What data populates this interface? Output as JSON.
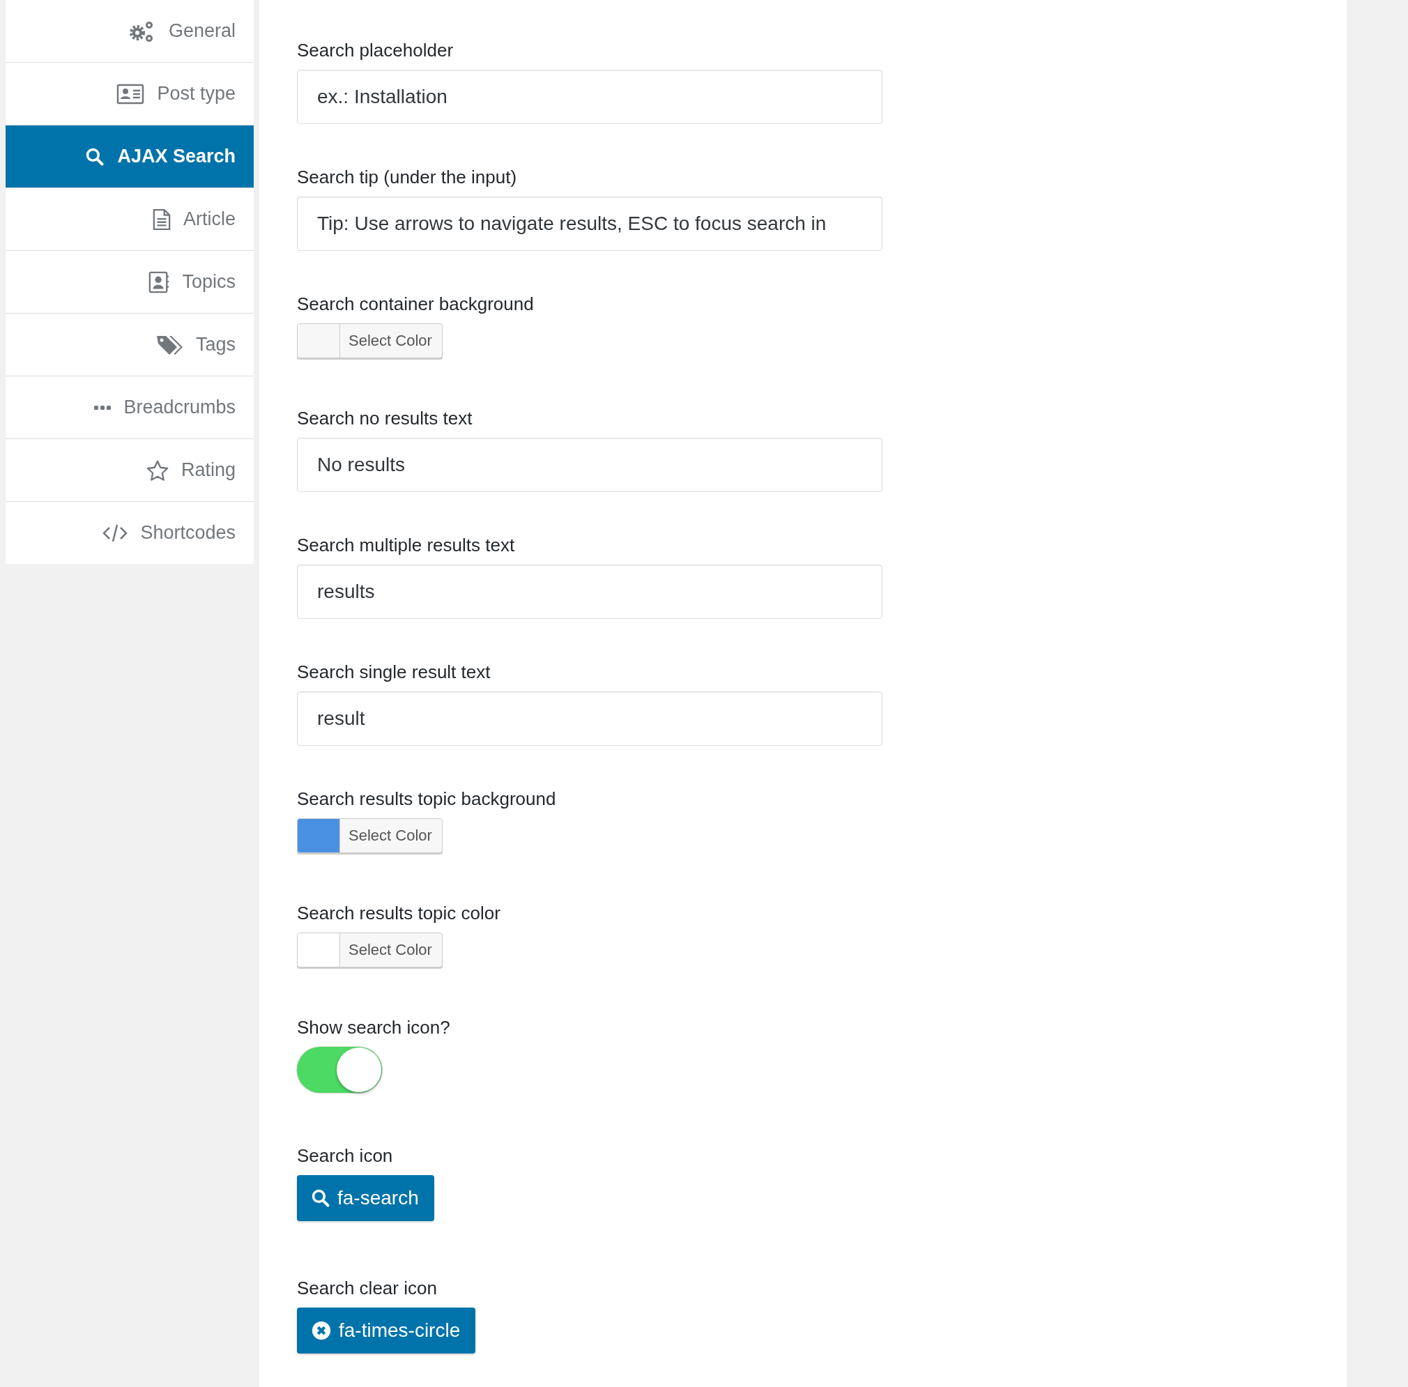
{
  "sidebar": {
    "items": [
      {
        "label": "General",
        "selected": false
      },
      {
        "label": "Post type",
        "selected": false
      },
      {
        "label": "AJAX Search",
        "selected": true
      },
      {
        "label": "Article",
        "selected": false
      },
      {
        "label": "Topics",
        "selected": false
      },
      {
        "label": "Tags",
        "selected": false
      },
      {
        "label": "Breadcrumbs",
        "selected": false
      },
      {
        "label": "Rating",
        "selected": false
      },
      {
        "label": "Shortcodes",
        "selected": false
      }
    ]
  },
  "settings": [
    {
      "kind": "text",
      "label": "Search placeholder",
      "value": "ex.: Installation"
    },
    {
      "kind": "text",
      "label": "Search tip (under the input)",
      "value": "Tip: Use arrows to navigate results, ESC to focus search in"
    },
    {
      "kind": "color",
      "label": "Search container background",
      "button": "Select Color",
      "color": "#f7f7f7"
    },
    {
      "kind": "text",
      "label": "Search no results text",
      "value": "No results"
    },
    {
      "kind": "text",
      "label": "Search multiple results text",
      "value": "results"
    },
    {
      "kind": "text",
      "label": "Search single result text",
      "value": "result"
    },
    {
      "kind": "color",
      "label": "Search results topic background",
      "button": "Select Color",
      "color": "#4a90e2"
    },
    {
      "kind": "color",
      "label": "Search results topic color",
      "button": "Select Color",
      "color": "#ffffff"
    },
    {
      "kind": "toggle",
      "label": "Show search icon?",
      "on": true
    },
    {
      "kind": "icon",
      "label": "Search icon",
      "button": "fa-search"
    },
    {
      "kind": "icon",
      "label": "Search clear icon",
      "button": "fa-times-circle"
    }
  ]
}
